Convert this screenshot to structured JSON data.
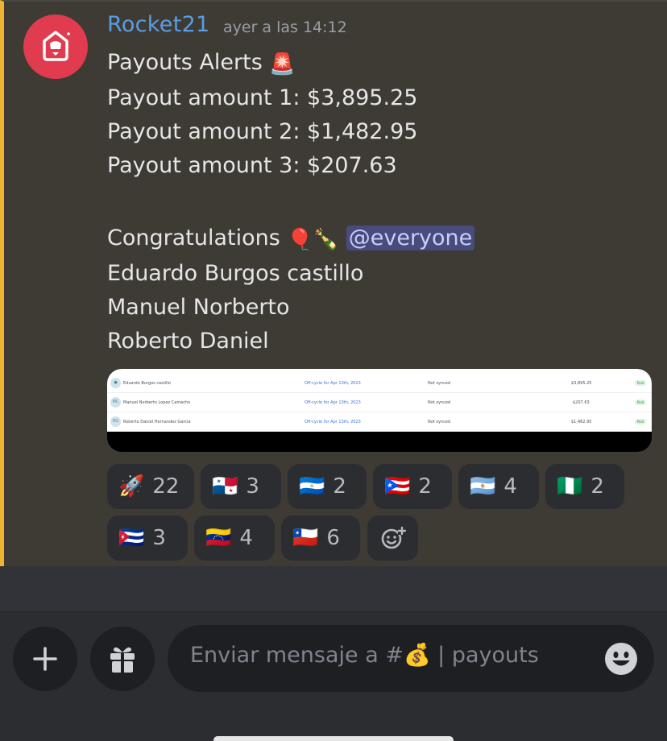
{
  "message": {
    "author": "Rocket21",
    "timestamp": "ayer a las 14:12",
    "title_text": "Payouts Alerts",
    "title_emoji": "🚨",
    "payout_lines": [
      "Payout amount 1:  $3,895.25",
      "Payout amount 2:  $1,482.95",
      "Payout amount 3:  $207.63"
    ],
    "congrats_text": "Congratulations",
    "congrats_emojis": [
      "🎈",
      "🍾"
    ],
    "mention": "@everyone",
    "names": [
      "Eduardo Burgos castillo",
      "Manuel Norberto",
      "Roberto Daniel"
    ]
  },
  "attachment": {
    "rows": [
      {
        "name": "Eduardo Burgos castillo",
        "cycle": "Off-cycle for Apr 13th, 2023",
        "status": "Not synced",
        "amount": "$3,895.25",
        "badge": "Paid"
      },
      {
        "name": "Manuel Norberto Lopez Camacho",
        "cycle": "Off-cycle for Apr 13th, 2023",
        "status": "Not synced",
        "amount": "$207.63",
        "badge": "Paid"
      },
      {
        "name": "Roberto Daniel Hernandez Garcia",
        "cycle": "Off-cycle for Apr 13th, 2023",
        "status": "Not synced",
        "amount": "$1,482.95",
        "badge": "Paid"
      }
    ]
  },
  "reactions": [
    {
      "emoji": "🚀",
      "count": "22"
    },
    {
      "emoji": "🇵🇦",
      "count": "3"
    },
    {
      "emoji": "🇳🇮",
      "count": "2"
    },
    {
      "emoji": "🇵🇷",
      "count": "2"
    },
    {
      "emoji": "🇦🇷",
      "count": "4"
    },
    {
      "emoji": "🇳🇬",
      "count": "2"
    },
    {
      "emoji": "🇨🇺",
      "count": "3"
    },
    {
      "emoji": "🇻🇪",
      "count": "4"
    },
    {
      "emoji": "🇨🇱",
      "count": "6"
    }
  ],
  "composer": {
    "placeholder": "Enviar mensaje a #💰 | payouts"
  },
  "icons": {
    "add": "plus-icon",
    "gift": "gift-icon",
    "emoji_picker": "smile-icon",
    "add_reaction": "add-reaction-icon"
  },
  "colors": {
    "message_bg": "#3e3b35",
    "highlight_bar": "#f0b232",
    "author": "#5a9de2",
    "mention_bg": "#474c7c",
    "avatar_bg": "#e03b4f"
  }
}
